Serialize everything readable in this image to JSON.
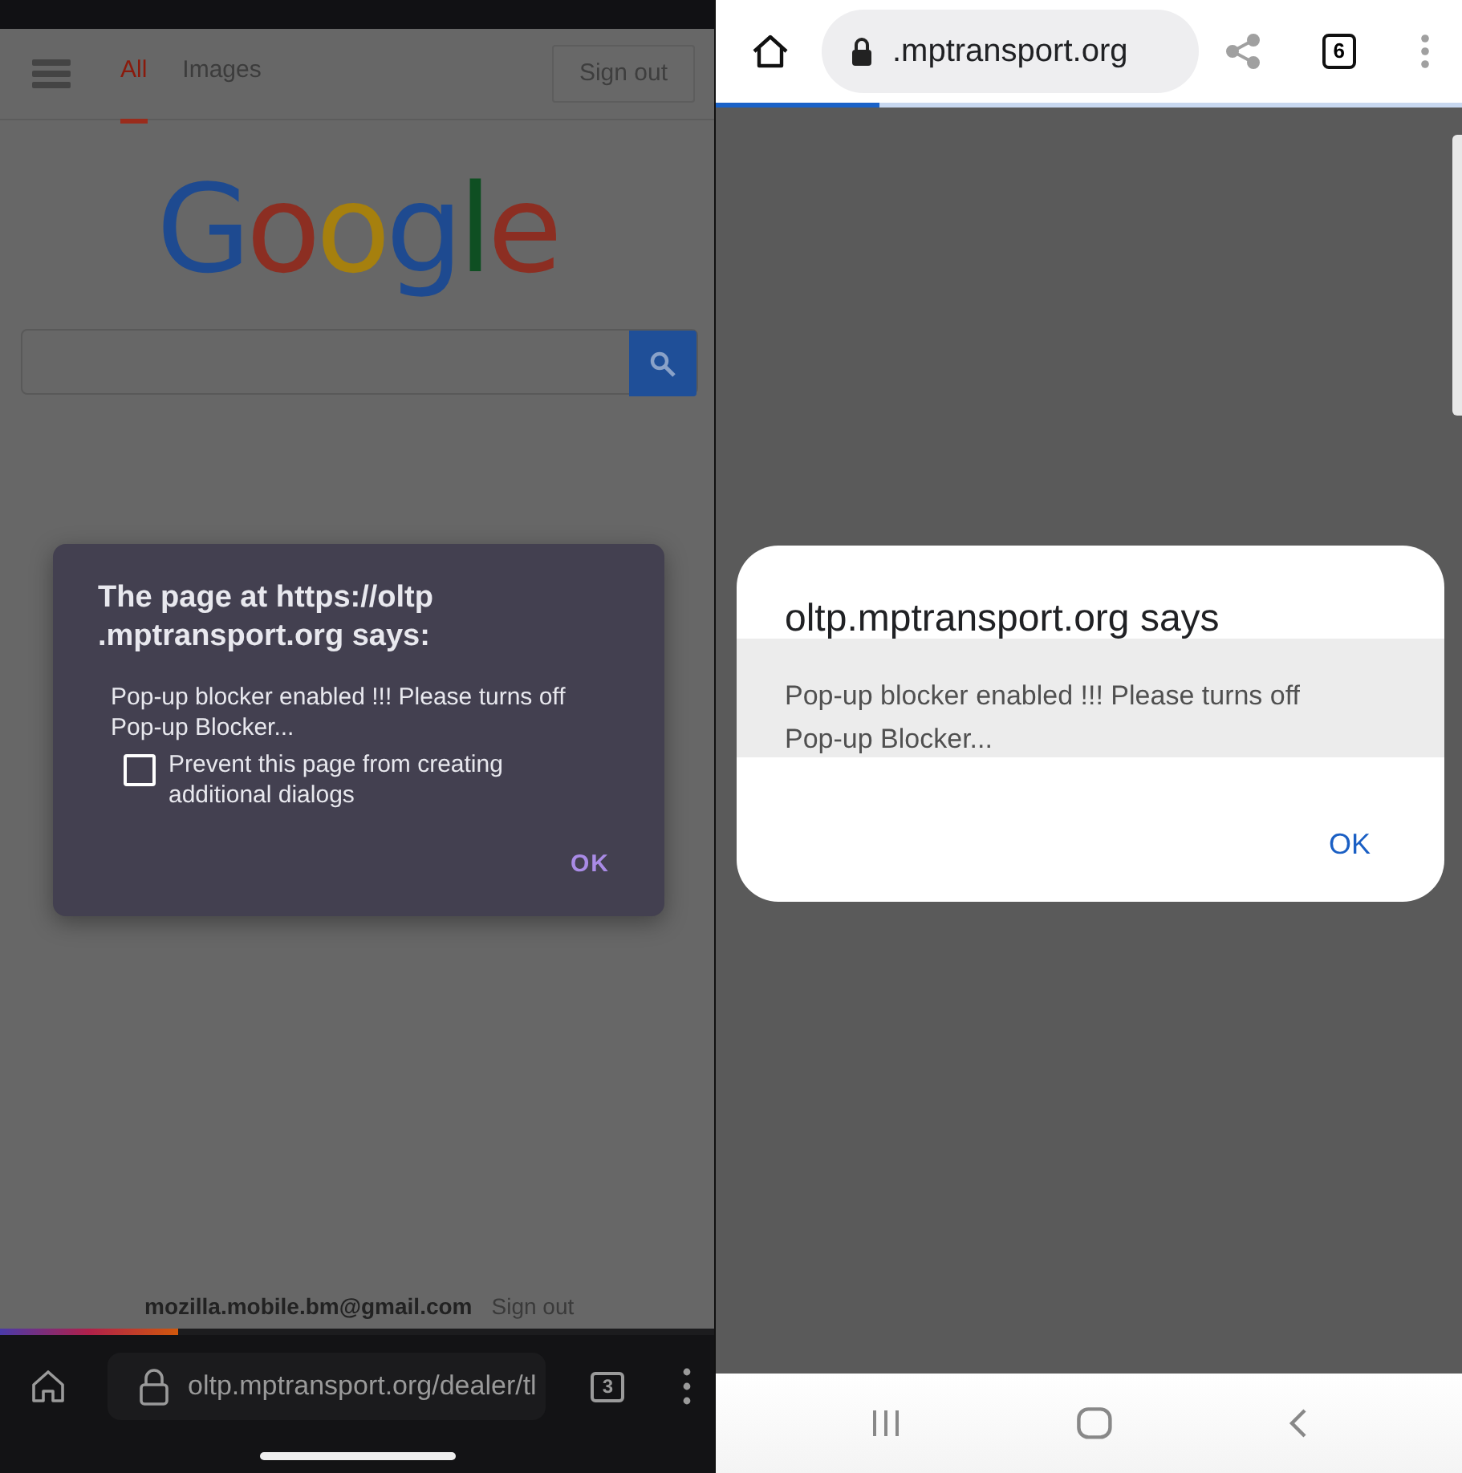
{
  "left_screen": {
    "header": {
      "tabs": [
        {
          "label": "All",
          "selected": true
        },
        {
          "label": "Images",
          "selected": false
        }
      ],
      "sign_out_button": "Sign out"
    },
    "logo_letters": [
      {
        "text": "G",
        "color": "#1e4a90"
      },
      {
        "text": "o",
        "color": "#8c2e22"
      },
      {
        "text": "o",
        "color": "#a6800e"
      },
      {
        "text": "g",
        "color": "#1e4a90"
      },
      {
        "text": "l",
        "color": "#0f4f22"
      },
      {
        "text": "e",
        "color": "#8c2e22"
      }
    ],
    "account": {
      "email": "mozilla.mobile.bm@gmail.com",
      "sign_out": "Sign out"
    },
    "dialog": {
      "title_lines": [
        "The page at https://oltp",
        ".mptransport.org says:"
      ],
      "message": "Pop-up blocker enabled !!! Please turns off Pop-up Blocker...",
      "checkbox": {
        "label": "Prevent this page from creating additional dialogs",
        "checked": false
      },
      "button": "OK"
    },
    "page_load": {
      "level": 0.25
    },
    "toolbar": {
      "url": "oltp.mptransport.org/dealer/tl",
      "tab_count": "3"
    }
  },
  "right_screen": {
    "toolbar": {
      "url": ".mptransport.org",
      "tab_count": "6"
    },
    "page_load": {
      "level": 0.22
    },
    "dialog": {
      "title": "oltp.mptransport.org says",
      "message": "Pop-up blocker enabled !!! Please turns off Pop-up Blocker...",
      "button": "OK"
    }
  }
}
